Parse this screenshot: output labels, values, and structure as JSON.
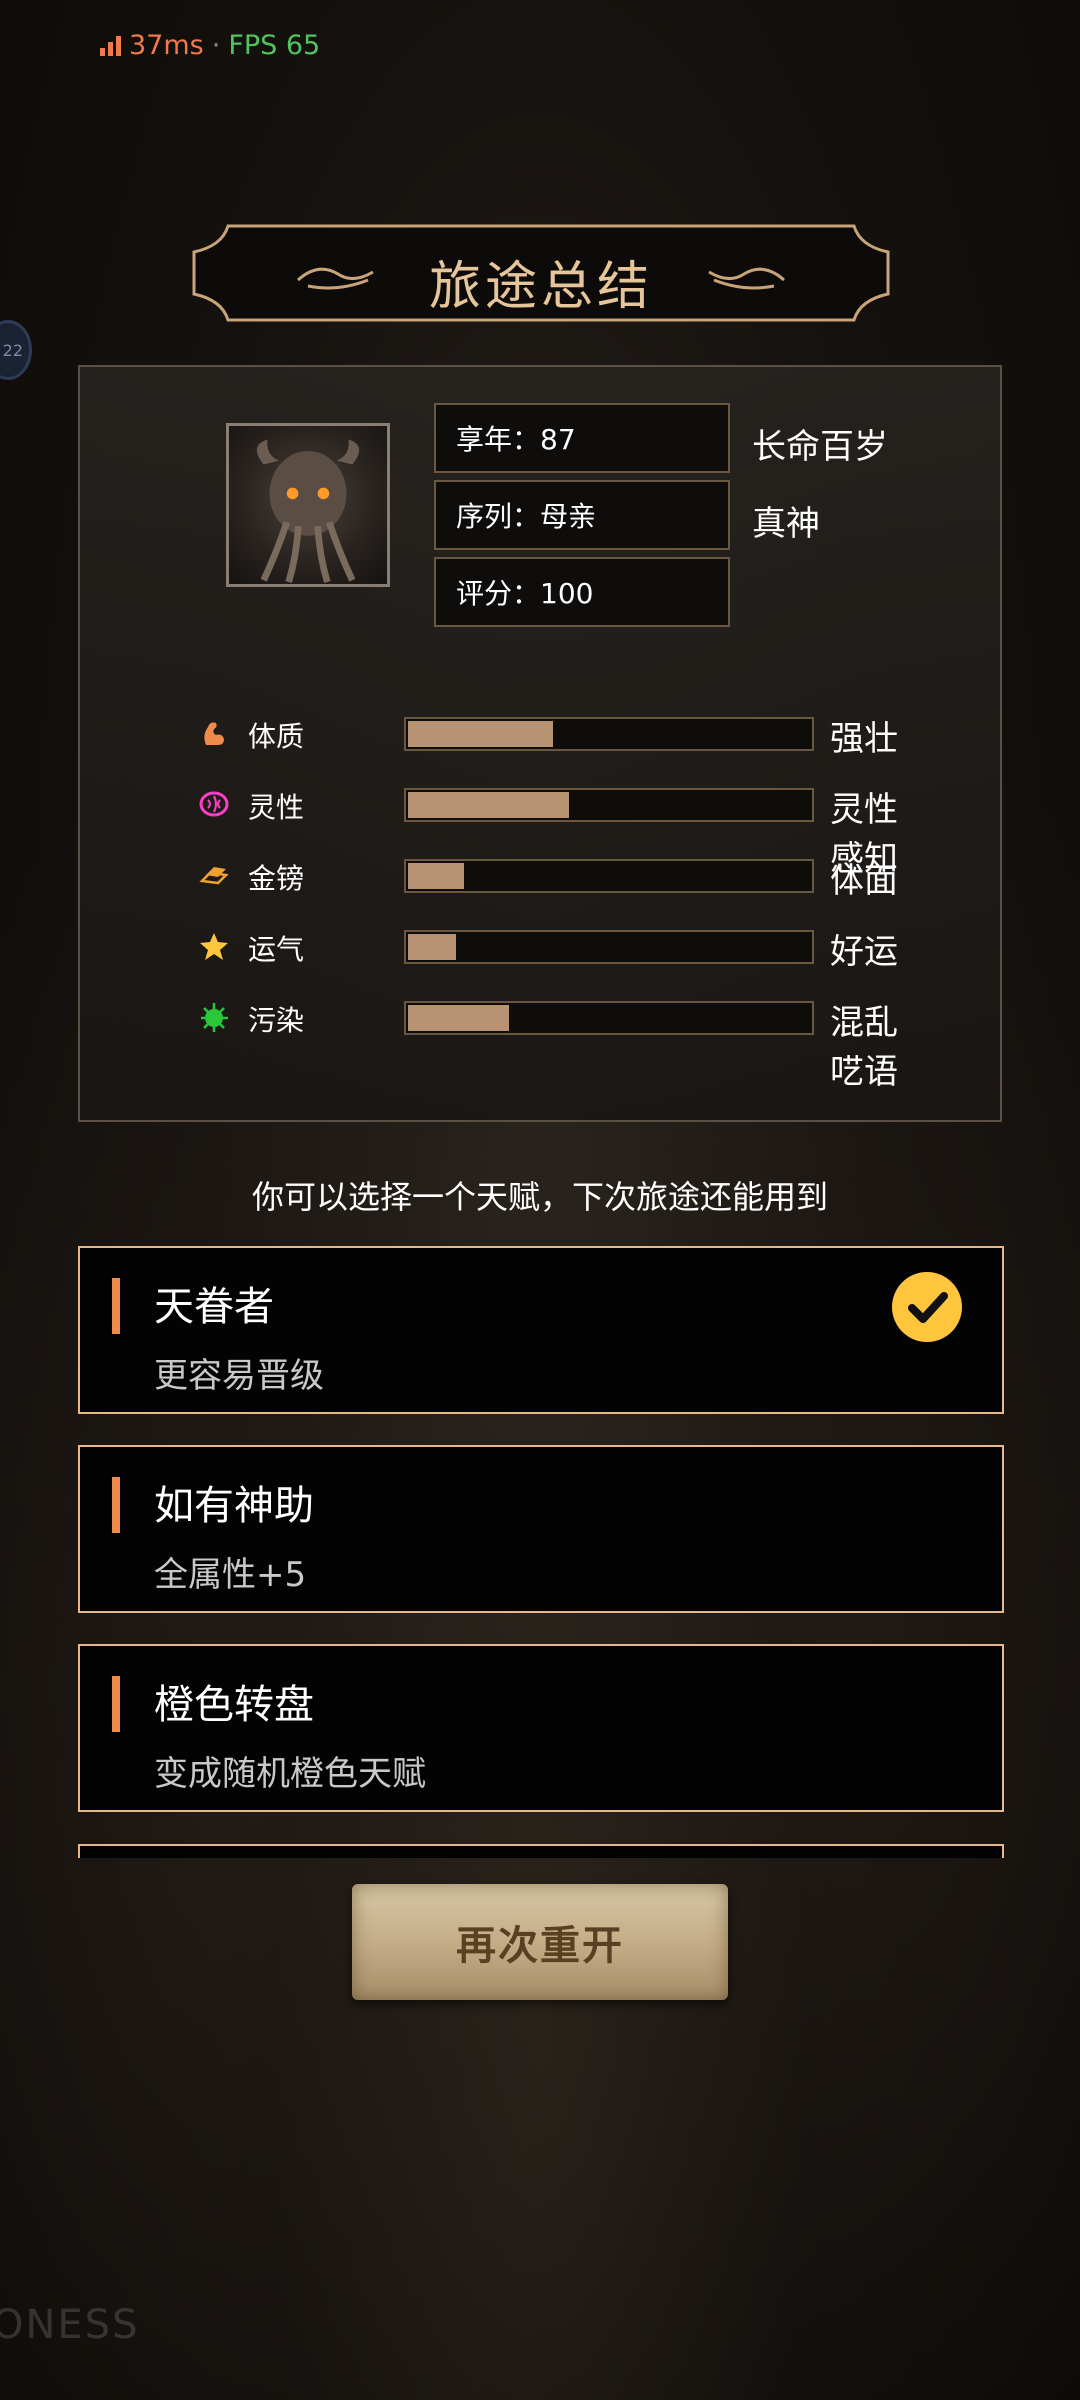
{
  "status": {
    "latency": "37ms",
    "separator": "·",
    "fps": "FPS 65"
  },
  "side_bubble": {
    "text": "22"
  },
  "title": "旅途总结",
  "summary": {
    "info": [
      {
        "label": "享年：87",
        "desc": "长命百岁"
      },
      {
        "label": "序列：母亲",
        "desc": "真神"
      },
      {
        "label": "评分：100",
        "desc": ""
      }
    ],
    "stats": [
      {
        "name": "体质",
        "icon": "muscle-icon",
        "icon_color": "#f08c4a",
        "level": 0.36,
        "desc": "强壮"
      },
      {
        "name": "灵性",
        "icon": "brain-icon",
        "icon_color": "#ff3ec8",
        "level": 0.4,
        "desc": "灵性感知"
      },
      {
        "name": "金镑",
        "icon": "gold-bars-icon",
        "icon_color": "#f0a030",
        "level": 0.14,
        "desc": "体面"
      },
      {
        "name": "运气",
        "icon": "star-icon",
        "icon_color": "#ffc53d",
        "level": 0.12,
        "desc": "好运"
      },
      {
        "name": "污染",
        "icon": "virus-icon",
        "icon_color": "#28c838",
        "level": 0.25,
        "desc": "混乱呓语"
      }
    ]
  },
  "hint": "你可以选择一个天赋，下次旅途还能用到",
  "talents": [
    {
      "name": "天眷者",
      "desc": "更容易晋级",
      "selected": true
    },
    {
      "name": "如有神助",
      "desc": "全属性+5",
      "selected": false
    },
    {
      "name": "橙色转盘",
      "desc": "变成随机橙色天赋",
      "selected": false
    }
  ],
  "restart_label": "再次重开",
  "watermark": "ONESS",
  "colors": {
    "accent_gold": "#e6c59a",
    "bar_fill": "#b89373",
    "card_border": "#e8b88a",
    "check": "#ffc53d"
  }
}
